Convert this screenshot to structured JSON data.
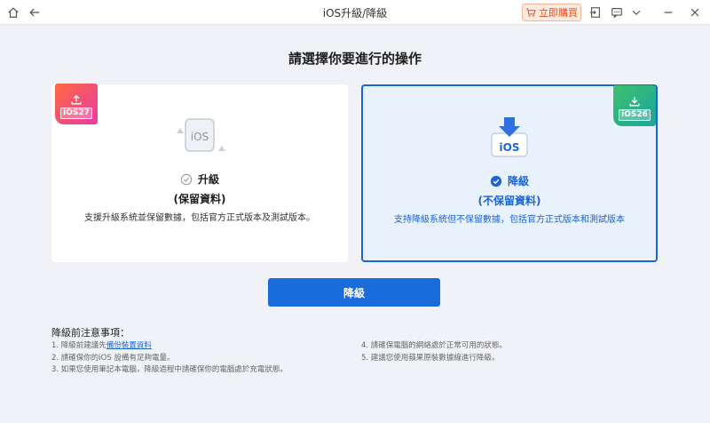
{
  "window": {
    "title": "iOS升級/降級",
    "buy_label": "立即購買"
  },
  "icons": {
    "home": "home-icon",
    "back": "back-arrow-icon",
    "cart": "cart-icon",
    "login": "login-icon",
    "feedback": "message-icon",
    "dropdown": "chevron-down-icon",
    "minimize": "minimize-icon",
    "close": "close-icon"
  },
  "main": {
    "title": "請選擇你要進行的操作",
    "options": [
      {
        "badge": "iOS27",
        "title": "升級",
        "subtitle": "(保留資料)",
        "description": "支援升級系統並保留數據，包括官方正式版本及測試版本。",
        "selected": false
      },
      {
        "badge": "iOS26",
        "title": "降級",
        "subtitle": "(不保留資料)",
        "description": "支持降級系統但不保留數據，包括官方正式版本和測試版本",
        "selected": true
      }
    ],
    "action_label": "降級"
  },
  "notes": {
    "title": "降級前注意事項：",
    "items_left": [
      {
        "prefix": "1. 降級前建議先",
        "link": "備份裝置資料"
      },
      {
        "text": "2. 請確保你的iOS 設備有足夠電量。"
      },
      {
        "text": "3. 如果您使用筆記本電腦，降級過程中請確保你的電腦處於充電狀態。"
      }
    ],
    "items_right": [
      {
        "text": "4. 請確保電腦的網絡處於正常可用的狀態。"
      },
      {
        "text": "5. 建議您使用蘋果原裝數據線進行降級。"
      }
    ]
  },
  "colors": {
    "accent": "#1a64d6",
    "background": "#f0f2f7",
    "buy": "#e0531f",
    "ios27_badge": "#e83aa6",
    "ios26_badge": "#3fbf6c"
  }
}
